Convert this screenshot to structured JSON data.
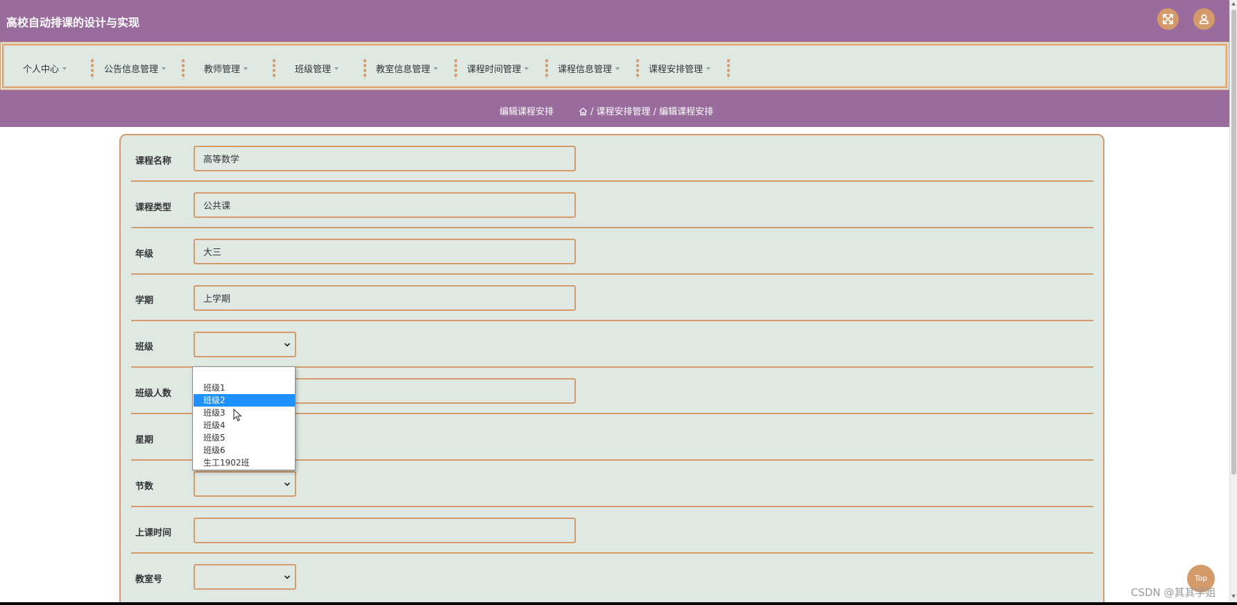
{
  "app": {
    "title": "高校自动排课的设计与实现"
  },
  "header": {
    "fullscreen_icon": "fullscreen-icon",
    "user_icon": "user-icon"
  },
  "nav": {
    "items": [
      {
        "label": "个人中心"
      },
      {
        "label": "公告信息管理"
      },
      {
        "label": "教师管理"
      },
      {
        "label": "班级管理"
      },
      {
        "label": "教室信息管理"
      },
      {
        "label": "课程时间管理"
      },
      {
        "label": "课程信息管理"
      },
      {
        "label": "课程安排管理"
      }
    ]
  },
  "breadcrumb": {
    "title": "编辑课程安排",
    "path": "/ 课程安排管理 / 编辑课程安排",
    "home_icon": "home-icon"
  },
  "form": {
    "course_name": {
      "label": "课程名称",
      "value": "高等数学"
    },
    "course_type": {
      "label": "课程类型",
      "value": "公共课"
    },
    "grade": {
      "label": "年级",
      "value": "大三"
    },
    "semester": {
      "label": "学期",
      "value": "上学期"
    },
    "class": {
      "label": "班级",
      "value": ""
    },
    "class_size": {
      "label": "班级人数",
      "value": ""
    },
    "weekday": {
      "label": "星期"
    },
    "period": {
      "label": "节数",
      "value": ""
    },
    "class_time": {
      "label": "上课时间",
      "value": ""
    },
    "classroom": {
      "label": "教室号",
      "value": ""
    }
  },
  "dropdown": {
    "options": [
      "",
      "班级1",
      "班级2",
      "班级3",
      "班级4",
      "班级5",
      "班级6",
      "生工1902班"
    ],
    "highlighted": "班级2"
  },
  "top_button": {
    "label": "Top"
  },
  "watermark": "CSDN @其其学姐",
  "colors": {
    "purple": "#9a6c9e",
    "accent": "#d49a6a",
    "panel": "#dfe8e3",
    "highlight": "#1e90ff"
  }
}
